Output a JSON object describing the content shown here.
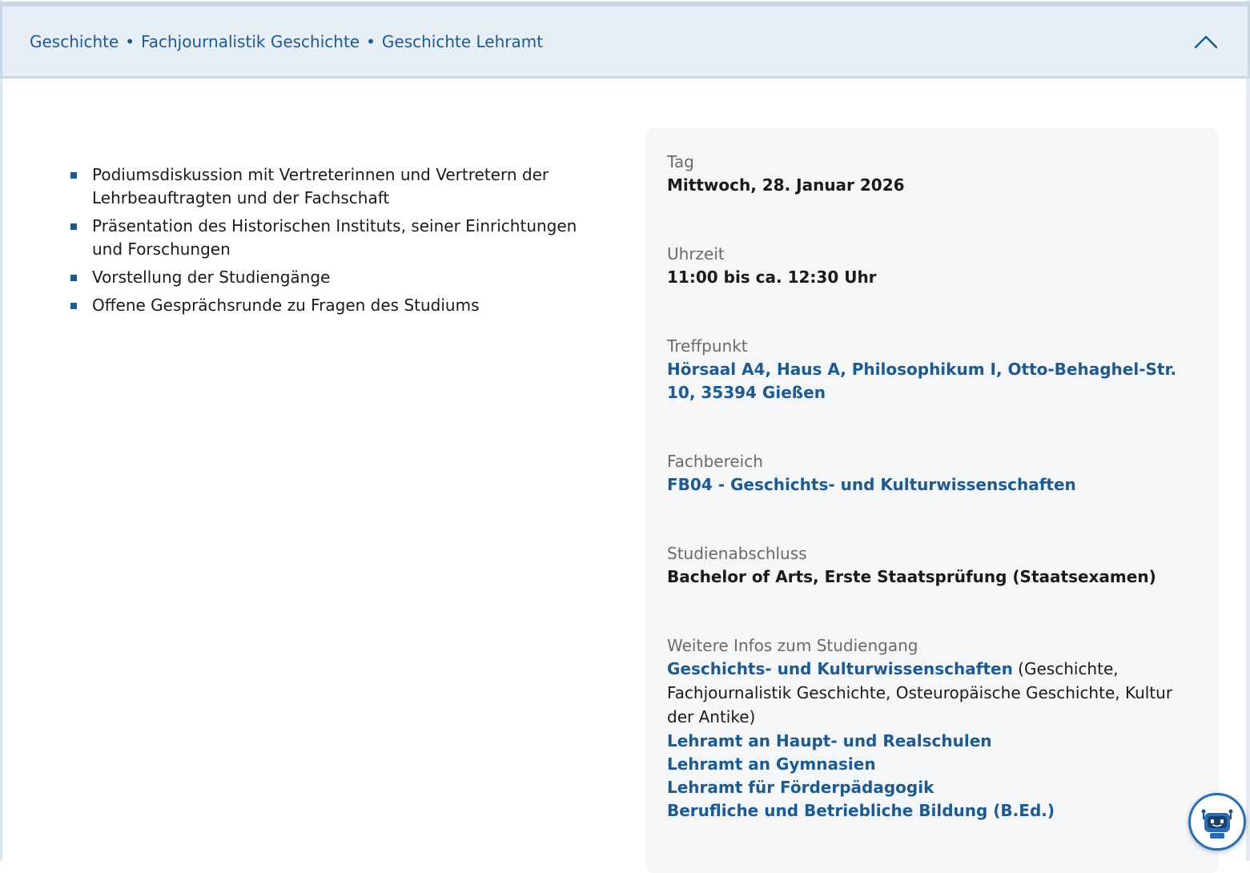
{
  "accordion": {
    "breadcrumbs": [
      "Geschichte",
      "Fachjournalistik Geschichte",
      "Geschichte Lehramt"
    ],
    "separator": "•",
    "icon": "chevron-up-icon"
  },
  "program_items": [
    "Podiumsdiskussion mit Vertreterinnen und Vertretern der Lehrbeauftragten und der Fachschaft",
    "Präsentation des Historischen Instituts, seiner Einrichtungen und Forschungen",
    "Vorstellung der Studiengänge",
    "Offene Gesprächsrunde zu Fragen des Studiums"
  ],
  "info": {
    "day": {
      "label": "Tag",
      "value": "Mittwoch, 28. Januar 2026"
    },
    "time": {
      "label": "Uhrzeit",
      "value": "11:00 bis ca. 12:30 Uhr"
    },
    "location": {
      "label": "Treffpunkt",
      "value": "Hörsaal A4, Haus A, Philosophikum I, Otto-Behaghel-Str. 10, 35394 Gießen"
    },
    "department": {
      "label": "Fachbereich",
      "value": "FB04 - Geschichts- und Kulturwissenschaften"
    },
    "degree": {
      "label": "Studienabschluss",
      "value": "Bachelor of Arts, Erste Staatsprüfung (Staatsexamen)"
    },
    "more": {
      "label": "Weitere Infos zum Studiengang",
      "primary_link": "Geschichts- und Kulturwissenschaften",
      "primary_note": " (Geschichte, Fachjournalistik Geschichte, Osteuropäische Geschichte, Kultur der Antike)",
      "links": [
        "Lehramt an Haupt- und Realschulen",
        "Lehramt an Gymnasien",
        "Lehramt für Förderpädagogik",
        "Berufliche und Betriebliche Bildung (B.Ed.)"
      ]
    }
  },
  "chatbot": {
    "icon": "robot-icon"
  },
  "colors": {
    "accent": "#1c5a92",
    "header_bg": "#e7eef5",
    "card_bg": "#f4f6f8",
    "label": "#6b6b6b"
  }
}
